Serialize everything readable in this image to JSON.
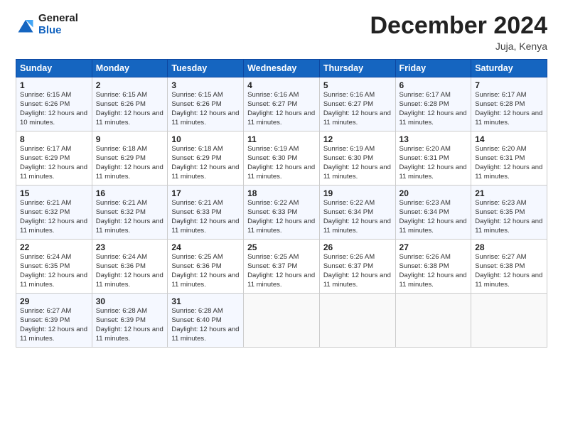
{
  "logo": {
    "line1": "General",
    "line2": "Blue"
  },
  "title": "December 2024",
  "location": "Juja, Kenya",
  "weekdays": [
    "Sunday",
    "Monday",
    "Tuesday",
    "Wednesday",
    "Thursday",
    "Friday",
    "Saturday"
  ],
  "weeks": [
    [
      {
        "day": "1",
        "sunrise": "6:15 AM",
        "sunset": "6:26 PM",
        "daylight": "12 hours and 10 minutes."
      },
      {
        "day": "2",
        "sunrise": "6:15 AM",
        "sunset": "6:26 PM",
        "daylight": "12 hours and 11 minutes."
      },
      {
        "day": "3",
        "sunrise": "6:15 AM",
        "sunset": "6:26 PM",
        "daylight": "12 hours and 11 minutes."
      },
      {
        "day": "4",
        "sunrise": "6:16 AM",
        "sunset": "6:27 PM",
        "daylight": "12 hours and 11 minutes."
      },
      {
        "day": "5",
        "sunrise": "6:16 AM",
        "sunset": "6:27 PM",
        "daylight": "12 hours and 11 minutes."
      },
      {
        "day": "6",
        "sunrise": "6:17 AM",
        "sunset": "6:28 PM",
        "daylight": "12 hours and 11 minutes."
      },
      {
        "day": "7",
        "sunrise": "6:17 AM",
        "sunset": "6:28 PM",
        "daylight": "12 hours and 11 minutes."
      }
    ],
    [
      {
        "day": "8",
        "sunrise": "6:17 AM",
        "sunset": "6:29 PM",
        "daylight": "12 hours and 11 minutes."
      },
      {
        "day": "9",
        "sunrise": "6:18 AM",
        "sunset": "6:29 PM",
        "daylight": "12 hours and 11 minutes."
      },
      {
        "day": "10",
        "sunrise": "6:18 AM",
        "sunset": "6:29 PM",
        "daylight": "12 hours and 11 minutes."
      },
      {
        "day": "11",
        "sunrise": "6:19 AM",
        "sunset": "6:30 PM",
        "daylight": "12 hours and 11 minutes."
      },
      {
        "day": "12",
        "sunrise": "6:19 AM",
        "sunset": "6:30 PM",
        "daylight": "12 hours and 11 minutes."
      },
      {
        "day": "13",
        "sunrise": "6:20 AM",
        "sunset": "6:31 PM",
        "daylight": "12 hours and 11 minutes."
      },
      {
        "day": "14",
        "sunrise": "6:20 AM",
        "sunset": "6:31 PM",
        "daylight": "12 hours and 11 minutes."
      }
    ],
    [
      {
        "day": "15",
        "sunrise": "6:21 AM",
        "sunset": "6:32 PM",
        "daylight": "12 hours and 11 minutes."
      },
      {
        "day": "16",
        "sunrise": "6:21 AM",
        "sunset": "6:32 PM",
        "daylight": "12 hours and 11 minutes."
      },
      {
        "day": "17",
        "sunrise": "6:21 AM",
        "sunset": "6:33 PM",
        "daylight": "12 hours and 11 minutes."
      },
      {
        "day": "18",
        "sunrise": "6:22 AM",
        "sunset": "6:33 PM",
        "daylight": "12 hours and 11 minutes."
      },
      {
        "day": "19",
        "sunrise": "6:22 AM",
        "sunset": "6:34 PM",
        "daylight": "12 hours and 11 minutes."
      },
      {
        "day": "20",
        "sunrise": "6:23 AM",
        "sunset": "6:34 PM",
        "daylight": "12 hours and 11 minutes."
      },
      {
        "day": "21",
        "sunrise": "6:23 AM",
        "sunset": "6:35 PM",
        "daylight": "12 hours and 11 minutes."
      }
    ],
    [
      {
        "day": "22",
        "sunrise": "6:24 AM",
        "sunset": "6:35 PM",
        "daylight": "12 hours and 11 minutes."
      },
      {
        "day": "23",
        "sunrise": "6:24 AM",
        "sunset": "6:36 PM",
        "daylight": "12 hours and 11 minutes."
      },
      {
        "day": "24",
        "sunrise": "6:25 AM",
        "sunset": "6:36 PM",
        "daylight": "12 hours and 11 minutes."
      },
      {
        "day": "25",
        "sunrise": "6:25 AM",
        "sunset": "6:37 PM",
        "daylight": "12 hours and 11 minutes."
      },
      {
        "day": "26",
        "sunrise": "6:26 AM",
        "sunset": "6:37 PM",
        "daylight": "12 hours and 11 minutes."
      },
      {
        "day": "27",
        "sunrise": "6:26 AM",
        "sunset": "6:38 PM",
        "daylight": "12 hours and 11 minutes."
      },
      {
        "day": "28",
        "sunrise": "6:27 AM",
        "sunset": "6:38 PM",
        "daylight": "12 hours and 11 minutes."
      }
    ],
    [
      {
        "day": "29",
        "sunrise": "6:27 AM",
        "sunset": "6:39 PM",
        "daylight": "12 hours and 11 minutes."
      },
      {
        "day": "30",
        "sunrise": "6:28 AM",
        "sunset": "6:39 PM",
        "daylight": "12 hours and 11 minutes."
      },
      {
        "day": "31",
        "sunrise": "6:28 AM",
        "sunset": "6:40 PM",
        "daylight": "12 hours and 11 minutes."
      },
      null,
      null,
      null,
      null
    ]
  ]
}
